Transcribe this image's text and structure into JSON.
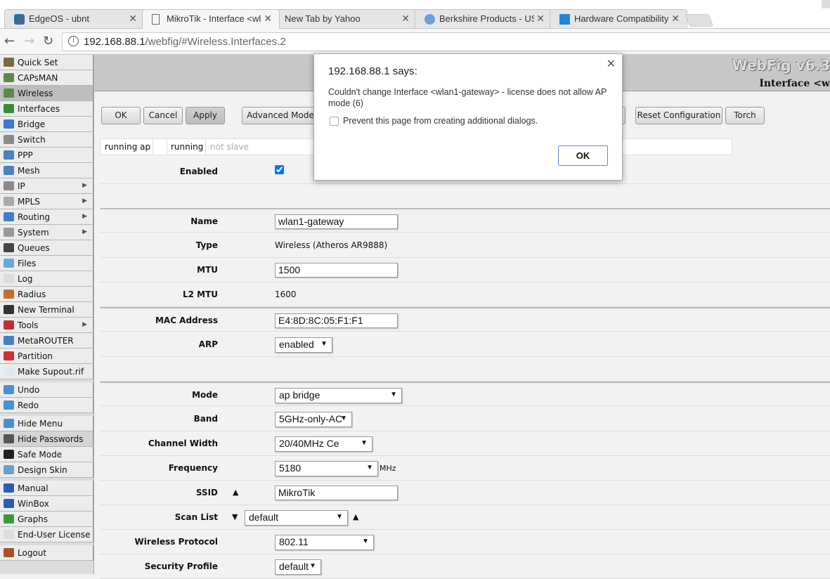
{
  "browser": {
    "tabs": [
      {
        "label": "EdgeOS - ubnt",
        "icon": "edgeos-icon",
        "color": "#3d6a9a"
      },
      {
        "label": "MikroTik - Interface <wla",
        "icon": "page-icon",
        "color": "#ffffff"
      },
      {
        "label": "New Tab by Yahoo",
        "icon": "",
        "color": ""
      },
      {
        "label": "Berkshire Products - USB",
        "icon": "berkshire-icon",
        "color": "#6aa0e0"
      },
      {
        "label": "Hardware Compatibility",
        "icon": "windows-icon",
        "color": "#1e88d8"
      }
    ],
    "url_host": "192.168.88.1",
    "url_path": "/webfig/#Wireless.Interfaces.2"
  },
  "sidebar": {
    "items": [
      {
        "label": "Quick Set",
        "icon": "quick-set-icon",
        "color": "#7a6a40"
      },
      {
        "label": "CAPsMAN",
        "icon": "antenna-icon",
        "color": "#5a8a50"
      },
      {
        "label": "Wireless",
        "icon": "antenna-icon",
        "color": "#5a8a50",
        "selected": true
      },
      {
        "label": "Interfaces",
        "icon": "interfaces-icon",
        "color": "#3a8a3a"
      },
      {
        "label": "Bridge",
        "icon": "bridge-icon",
        "color": "#3a7ad0"
      },
      {
        "label": "Switch",
        "icon": "switch-icon",
        "color": "#8a8a8a"
      },
      {
        "label": "PPP",
        "icon": "ppp-icon",
        "color": "#4a80c0"
      },
      {
        "label": "Mesh",
        "icon": "mesh-icon",
        "color": "#4a80c0"
      },
      {
        "label": "IP",
        "icon": "ip-icon",
        "color": "#8a8a8a",
        "submenu": true
      },
      {
        "label": "MPLS",
        "icon": "mpls-icon",
        "color": "#aaaaaa",
        "submenu": true
      },
      {
        "label": "Routing",
        "icon": "routing-icon",
        "color": "#3a80d0",
        "submenu": true
      },
      {
        "label": "System",
        "icon": "gear-icon",
        "color": "#999999",
        "submenu": true
      },
      {
        "label": "Queues",
        "icon": "queues-icon",
        "color": "#444444"
      },
      {
        "label": "Files",
        "icon": "folder-icon",
        "color": "#6aa8d8"
      },
      {
        "label": "Log",
        "icon": "log-icon",
        "color": "#dddddd"
      },
      {
        "label": "Radius",
        "icon": "radius-icon",
        "color": "#c07030"
      },
      {
        "label": "New Terminal",
        "icon": "terminal-icon",
        "color": "#333333"
      },
      {
        "label": "Tools",
        "icon": "tools-icon",
        "color": "#c03030",
        "submenu": true
      },
      {
        "label": "MetaROUTER",
        "icon": "metarouter-icon",
        "color": "#4a80c0"
      },
      {
        "label": "Partition",
        "icon": "partition-icon",
        "color": "#d03030"
      },
      {
        "label": "Make Supout.rif",
        "icon": "document-icon",
        "color": "#e0e8f0"
      },
      {
        "label": "Undo",
        "icon": "undo-icon",
        "color": "#4a90d0",
        "gap": true
      },
      {
        "label": "Redo",
        "icon": "redo-icon",
        "color": "#4a90d0"
      },
      {
        "label": "Hide Menu",
        "icon": "hide-menu-icon",
        "color": "#4a90d0",
        "gap": true
      },
      {
        "label": "Hide Passwords",
        "icon": "password-icon",
        "color": "#555555",
        "highlight": true
      },
      {
        "label": "Safe Mode",
        "icon": "umbrella-icon",
        "color": "#222222"
      },
      {
        "label": "Design Skin",
        "icon": "design-skin-icon",
        "color": "#6aa0d0"
      },
      {
        "label": "Manual",
        "icon": "help-icon",
        "color": "#2a5ac0",
        "gap": true
      },
      {
        "label": "WinBox",
        "icon": "winbox-icon",
        "color": "#2a60b0"
      },
      {
        "label": "Graphs",
        "icon": "graphs-icon",
        "color": "#3a9a3a"
      },
      {
        "label": "End-User License",
        "icon": "license-icon",
        "color": "#dddddd"
      },
      {
        "label": "Logout",
        "icon": "logout-icon",
        "color": "#b05020",
        "gap": true
      }
    ]
  },
  "header": {
    "app_title": "WebFig v6.3",
    "page_title": "Interface <w"
  },
  "toolbar": {
    "ok": "OK",
    "cancel": "Cancel",
    "apply": "Apply",
    "advanced": "Advanced Mode",
    "reset": "Reset Configuration",
    "torch": "Torch"
  },
  "status": {
    "s1": "running ap",
    "s2": "running",
    "s3": "not slave"
  },
  "form": {
    "enabled_label": "Enabled",
    "enabled": true,
    "name_label": "Name",
    "name": "wlan1-gateway",
    "type_label": "Type",
    "type": "Wireless (Atheros AR9888)",
    "mtu_label": "MTU",
    "mtu": "1500",
    "l2mtu_label": "L2 MTU",
    "l2mtu": "1600",
    "mac_label": "MAC Address",
    "mac": "E4:8D:8C:05:F1:F1",
    "arp_label": "ARP",
    "arp": "enabled",
    "mode_label": "Mode",
    "mode": "ap bridge",
    "band_label": "Band",
    "band": "5GHz-only-AC",
    "cw_label": "Channel Width",
    "cw": "20/40MHz Ce",
    "freq_label": "Frequency",
    "freq": "5180",
    "freq_unit": "MHz",
    "ssid_label": "SSID",
    "ssid": "MikroTik",
    "scan_label": "Scan List",
    "scan": "default",
    "proto_label": "Wireless Protocol",
    "proto": "802.11",
    "sec_label": "Security Profile",
    "sec": "default"
  },
  "dialog": {
    "title": "192.168.88.1 says:",
    "message": "Couldn't change Interface <wlan1-gateway> - license does not allow AP mode (6)",
    "checkbox_label": "Prevent this page from creating additional dialogs.",
    "ok": "OK"
  }
}
